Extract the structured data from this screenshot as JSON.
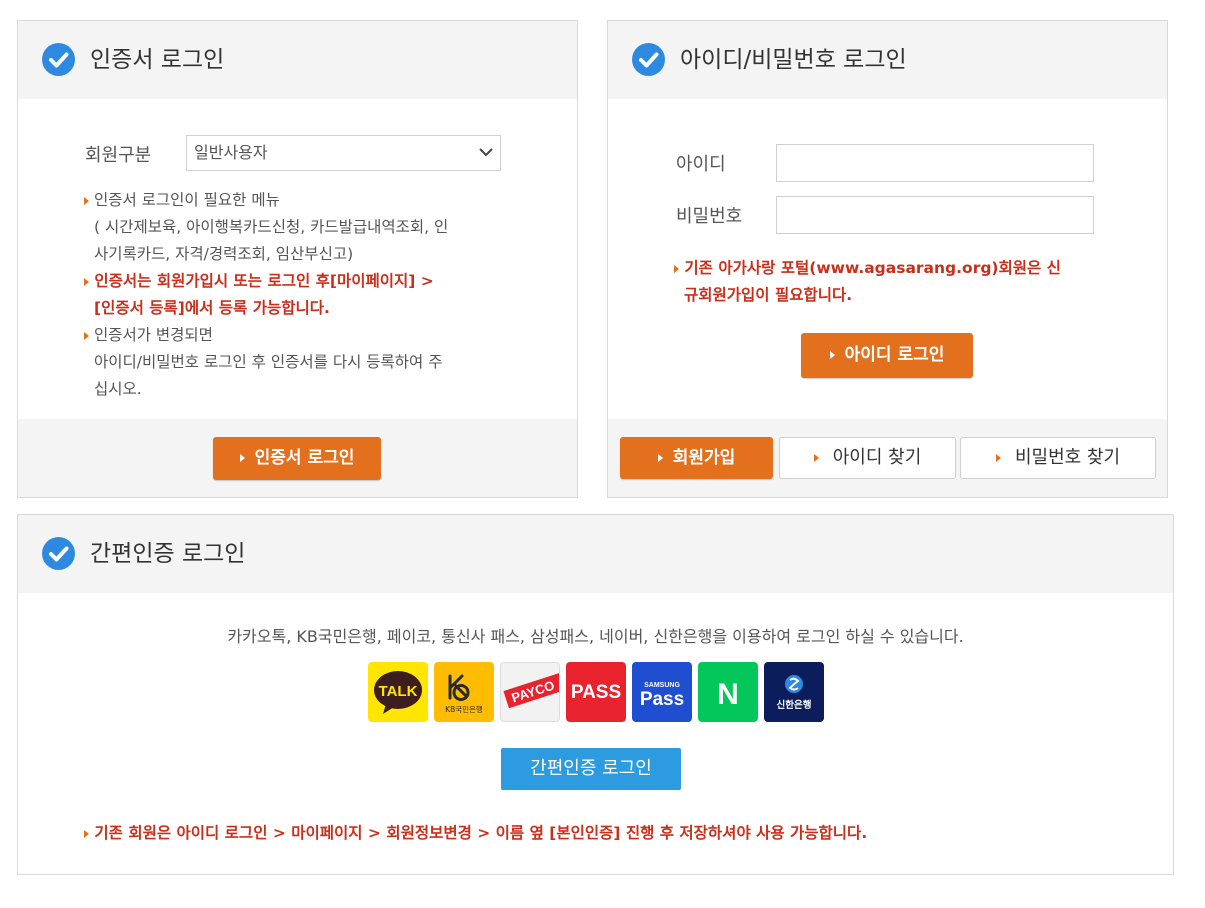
{
  "cert_login": {
    "title": "인증서 로그인",
    "member_type_label": "회원구분",
    "member_type_selected": "일반사용자",
    "note1_title": "인증서 로그인이 필요한 메뉴",
    "note1_line1": "( 시간제보육, 아이행복카드신청, 카드발급내역조회, 인",
    "note1_line2": "사기록카드, 자격/경력조회, 임산부신고)",
    "note2_line1": "인증서는 회원가입시 또는 로그인 후[마이페이지] >",
    "note2_line2": "[인증서 등록]에서 등록 가능합니다.",
    "note3_line1": "인증서가 변경되면",
    "note3_line2": "아이디/비밀번호 로그인 후 인증서를 다시 등록하여 주",
    "note3_line3": "십시오.",
    "login_button": "인증서 로그인"
  },
  "id_login": {
    "title": "아이디/비밀번호 로그인",
    "id_label": "아이디",
    "id_value": "",
    "password_label": "비밀번호",
    "password_value": "",
    "notice_line1": "기존 아가사랑 포털(www.agasarang.org)회원은 신",
    "notice_line2": "규회원가입이 필요합니다.",
    "login_button": "아이디 로그인",
    "signup_button": "회원가입",
    "find_id_button": "아이디 찾기",
    "find_password_button": "비밀번호 찾기"
  },
  "simple_auth": {
    "title": "간편인증 로그인",
    "description": "카카오톡, KB국민은행, 페이코, 통신사 패스, 삼성패스, 네이버, 신한은행을 이용하여 로그인 하실 수 있습니다.",
    "services": [
      {
        "name": "kakaotalk",
        "label": "TALK",
        "color": "#ffe500"
      },
      {
        "name": "kb",
        "label": "KB국민은행",
        "color": "#ffbc00"
      },
      {
        "name": "payco",
        "label": "PAYCO",
        "color": "#e8232d"
      },
      {
        "name": "pass",
        "label": "PASS",
        "color": "#e8232d"
      },
      {
        "name": "samsung-pass",
        "label_top": "SAMSUNG",
        "label": "Pass",
        "color": "#1f4fd0"
      },
      {
        "name": "naver",
        "label": "N",
        "color": "#03c75a"
      },
      {
        "name": "shinhan",
        "label": "신한은행",
        "color": "#0b1e5b"
      }
    ],
    "login_button": "간편인증 로그인",
    "notice": "기존 회원은 아이디 로그인 > 마이페이지 > 회원정보변경 > 이름 옆 [본인인증] 진행 후 저장하셔야 사용 가능합니다."
  },
  "colors": {
    "accent_orange": "#e3701c",
    "accent_blue": "#2d8ae0",
    "notice_red": "#c9301c"
  }
}
